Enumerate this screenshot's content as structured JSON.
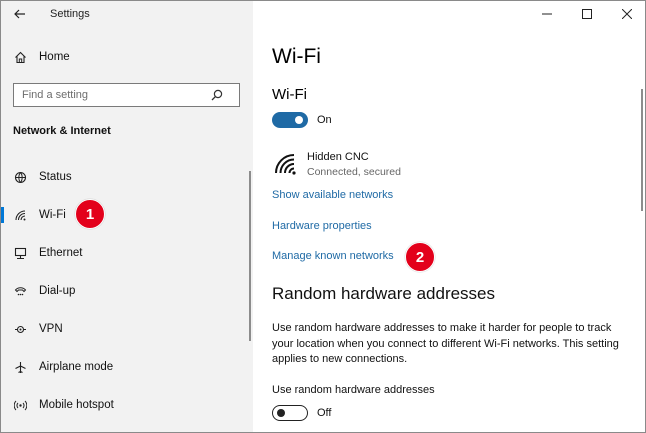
{
  "window": {
    "app_title": "Settings",
    "accent_color": "#0078d7",
    "controls": [
      {
        "name": "minimize-button",
        "icon": "minimize-icon"
      },
      {
        "name": "maximize-button",
        "icon": "maximize-icon"
      },
      {
        "name": "close-button",
        "icon": "close-icon"
      }
    ]
  },
  "sidebar": {
    "home_label": "Home",
    "search_placeholder": "Find a setting",
    "section_header": "Network & Internet",
    "items": [
      {
        "label": "Status",
        "icon": "globe-status-icon",
        "selected": false
      },
      {
        "label": "Wi-Fi",
        "icon": "wifi-icon",
        "selected": true
      },
      {
        "label": "Ethernet",
        "icon": "ethernet-icon",
        "selected": false
      },
      {
        "label": "Dial-up",
        "icon": "dialup-icon",
        "selected": false
      },
      {
        "label": "VPN",
        "icon": "vpn-icon",
        "selected": false
      },
      {
        "label": "Airplane mode",
        "icon": "airplane-icon",
        "selected": false
      },
      {
        "label": "Mobile hotspot",
        "icon": "hotspot-icon",
        "selected": false
      }
    ]
  },
  "annotations": {
    "badge_1": "1",
    "badge_2": "2",
    "badge_color": "#e3001b"
  },
  "main": {
    "page_title": "Wi-Fi",
    "wifi_heading": "Wi-Fi",
    "wifi_toggle": {
      "state": "on",
      "label": "On"
    },
    "network": {
      "name": "Hidden CNC",
      "status": "Connected, secured"
    },
    "links": {
      "show_networks": "Show available networks",
      "hardware_properties": "Hardware properties",
      "manage_known": "Manage known networks"
    },
    "random_section": {
      "heading": "Random hardware addresses",
      "description": "Use random hardware addresses to make it harder for people to track your location when you connect to different Wi-Fi networks. This setting applies to new connections.",
      "toggle_label_title": "Use random hardware addresses",
      "toggle": {
        "state": "off",
        "label": "Off"
      }
    },
    "link_color": "#1f6aa5"
  }
}
